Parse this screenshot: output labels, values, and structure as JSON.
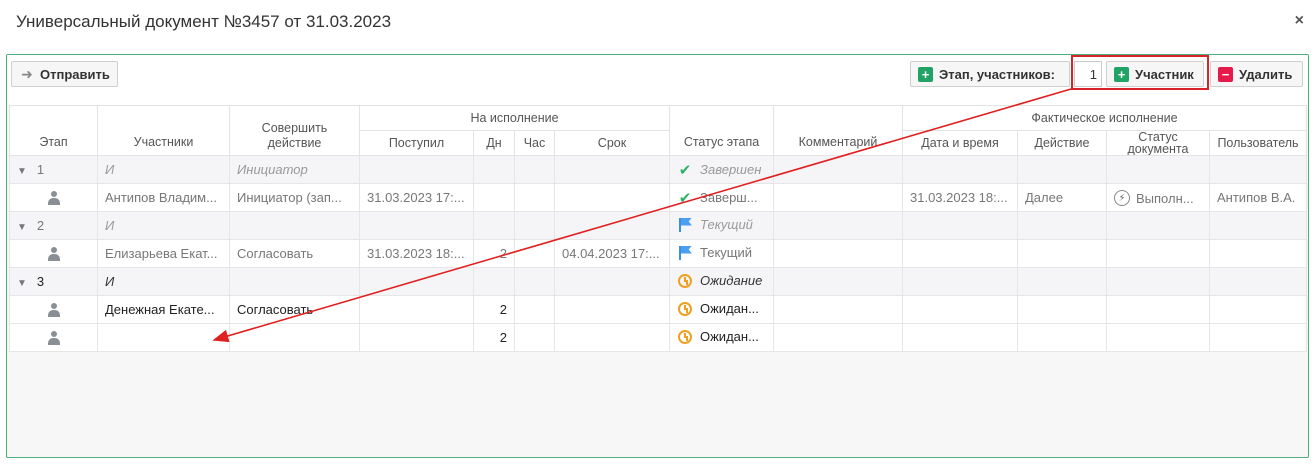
{
  "dialog": {
    "title": "Универсальный документ №3457 от 31.03.2023",
    "close_glyph": "×"
  },
  "toolbar": {
    "send_label": "Отправить",
    "stage_label": "Этап, участников:",
    "count_value": "1",
    "participant_label": "Участник",
    "delete_label": "Удалить"
  },
  "headers": {
    "stage": "Этап",
    "participants": "Участники",
    "action": "Совершить действие",
    "group_execution": "На исполнение",
    "received": "Поступил",
    "days": "Дн",
    "hours": "Час",
    "deadline": "Срок",
    "stage_status": "Статус этапа",
    "comment": "Комментарий",
    "group_actual": "Фактическое исполнение",
    "datetime": "Дата и время",
    "act": "Действие",
    "doc_status": "Статус документа",
    "user": "Пользователь"
  },
  "rows": [
    {
      "kind": "stage",
      "num": "1",
      "participant": "И",
      "action": "Инициатор",
      "status": "Завершен",
      "status_icon": "check-icon"
    },
    {
      "kind": "member",
      "participant": "Антипов Владим...",
      "action": "Инициатор (зап...",
      "received": "31.03.2023 17:...",
      "days": "",
      "deadline": "",
      "status": "Заверш...",
      "status_icon": "check-icon",
      "fact_date": "31.03.2023 18:...",
      "fact_action": "Далее",
      "doc_status": "Выполн...",
      "user": "Антипов В.А."
    },
    {
      "kind": "stage",
      "num": "2",
      "participant": "И",
      "action": "",
      "status": "Текущий",
      "status_icon": "flag-icon"
    },
    {
      "kind": "member",
      "participant": "Елизарьева Екат...",
      "action": "Согласовать",
      "received": "31.03.2023 18:...",
      "days": "2",
      "deadline": "04.04.2023 17:...",
      "status": "Текущий",
      "status_icon": "flag-icon"
    },
    {
      "kind": "stage",
      "num": "3",
      "participant": "И",
      "action": "",
      "status": "Ожидание",
      "status_icon": "clock-icon",
      "dark": true
    },
    {
      "kind": "member",
      "participant": "Денежная Екате...",
      "action": "Согласовать",
      "received": "",
      "days": "2",
      "deadline": "",
      "status": "Ожидан...",
      "status_icon": "clock-icon",
      "dark": true
    },
    {
      "kind": "member",
      "participant": "",
      "action": "",
      "received": "",
      "days": "2",
      "deadline": "",
      "status": "Ожидан...",
      "status_icon": "clock-icon",
      "dark": true
    }
  ],
  "colors": {
    "accent_green": "#21a366",
    "delete_red": "#e5194a",
    "annotation_red": "#d9232b"
  }
}
